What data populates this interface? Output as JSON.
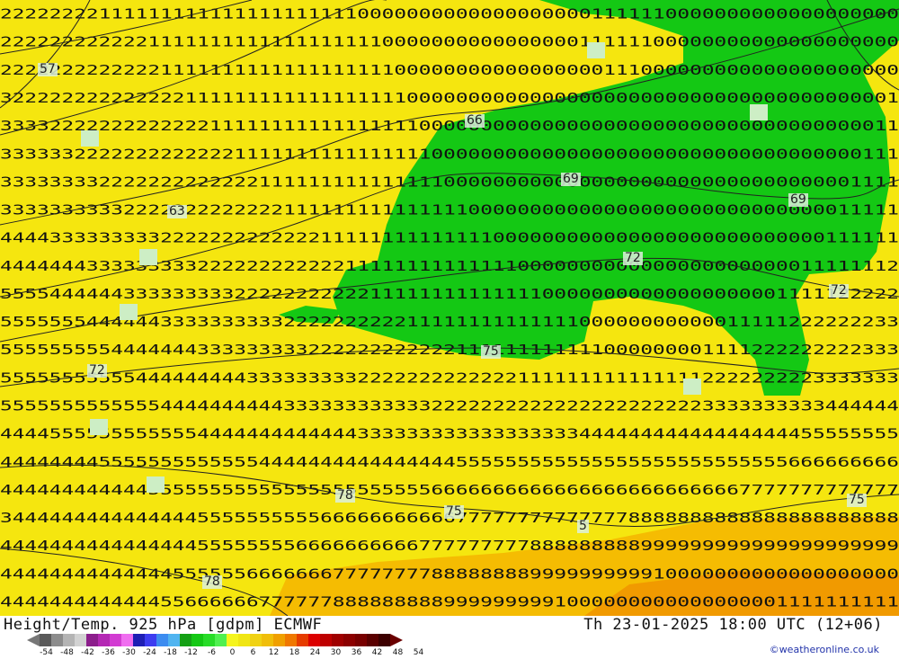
{
  "map": {
    "background_color": "#f5e60f",
    "green_color": "#14c814",
    "orange_color": "#f5b400",
    "digit_color": "#111111",
    "rows": [
      "2222222211111111111111111111100000000000000000001111110000000000000000000",
      "2222222222221111111111111111111000000000000000011111100000000000000000000",
      "2222222222222111111111111111111100000000000000000111000000000000000000000",
      "3222222222222221111111111111111110000000000000000000000000000000000000001",
      "3333222222222222211111111111111111000000000000000000000000000000000000011",
      "3333332222222222222111111111111111100000000000000000000000000000000000111",
      "3333333322222222222221111111111111110000000000000000000000000000000001111",
      "3333333333222222222222211111111111111100000000000000000000000000000011111",
      "4444333333333222222222222211111111111111000000000000000000000000000111111",
      "4444444333333333222222222222111111111111110000000000000000000000011111112",
      "5555444444333333333222222222221111111111111100000000000000000001111122222",
      "5555555444444333333333322222222221111111111111100000000000011111222222233",
      "5555555554444444333333333222222222222111111111111000000001111222222222333",
      "5555555555544444444433333333322222222222221111111111111112222222223333333",
      "5555555555555444444444433333333333322222222222222222222223333333333444444",
      "4444555555555555444444444444433333333333333333344444444444444444455555555",
      "4444444455555555555554444444444444444555555555555555555555555555666666666",
      "4444444444445555555555555555555555566666666666666666666666667777777777777",
      "3444444444444444555555555566666666666777777777777778888888888888888888888",
      "4444444444444444555555556666666666777777777888888888999999999999999999999",
      "4444444444444455555566666667777777788888888999999999910000000000000000000",
      "4444444444444556666667777778888888889999999991000000000000000001111111111"
    ],
    "contour_labels": [
      "57",
      "63",
      "66",
      "69",
      "69",
      "72",
      "72",
      "75",
      "78",
      "75",
      "5",
      "75",
      "78",
      "72"
    ]
  },
  "footer": {
    "title": "Height/Temp. 925 hPa [gdpm] ECMWF",
    "timestamp": "Th 23-01-2025 18:00 UTC (12+06)",
    "credit": "©weatheronline.co.uk"
  },
  "legend": {
    "colors": [
      "#5a5a5a",
      "#8c8c8c",
      "#b4b4b4",
      "#d2d2d2",
      "#8c1e8c",
      "#b428b4",
      "#d23cd2",
      "#f06ef0",
      "#1e1eb4",
      "#3c3cf0",
      "#3c8cf0",
      "#50b4f0",
      "#14a014",
      "#14c814",
      "#28dc28",
      "#50f050",
      "#f5f51e",
      "#f0e614",
      "#f0d214",
      "#f0be0a",
      "#f0a000",
      "#f07800",
      "#e63c00",
      "#dc0000",
      "#be0000",
      "#a00000",
      "#8c0000",
      "#780000",
      "#5a0000",
      "#3c0000"
    ],
    "ticks": [
      "-54",
      "-48",
      "-42",
      "-36",
      "-30",
      "-24",
      "-18",
      "-12",
      "-6",
      "0",
      "6",
      "12",
      "18",
      "24",
      "30",
      "36",
      "42",
      "48",
      "54"
    ]
  }
}
